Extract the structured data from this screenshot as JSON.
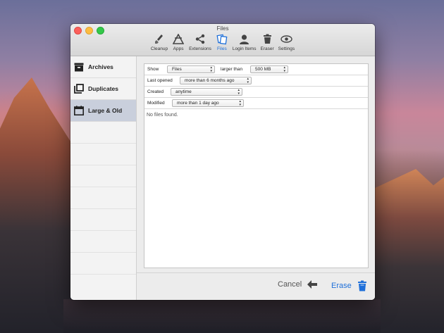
{
  "window": {
    "title": "Files"
  },
  "toolbar": {
    "items": [
      {
        "label": "Cleanup",
        "icon": "broom-icon"
      },
      {
        "label": "Apps",
        "icon": "apps-icon"
      },
      {
        "label": "Extensions",
        "icon": "share-icon"
      },
      {
        "label": "Files",
        "icon": "files-icon",
        "active": true
      },
      {
        "label": "Login Items",
        "icon": "user-icon"
      },
      {
        "label": "Eraser",
        "icon": "trash-icon"
      },
      {
        "label": "Settings",
        "icon": "settings-icon"
      }
    ]
  },
  "sidebar": {
    "items": [
      {
        "label": "Archives",
        "icon": "archive-icon"
      },
      {
        "label": "Duplicates",
        "icon": "duplicates-icon"
      },
      {
        "label": "Large & Old",
        "icon": "calendar-icon",
        "selected": true
      }
    ]
  },
  "filters": {
    "show_label": "Show",
    "show_value": "Files",
    "larger_than_label": "larger than",
    "larger_than_value": "500 MB",
    "last_opened_label": "Last opened",
    "last_opened_value": "more than 6 months ago",
    "created_label": "Created",
    "created_value": "anytime",
    "modified_label": "Modified",
    "modified_value": "more than 1 day ago"
  },
  "results": {
    "empty_text": "No files found."
  },
  "actions": {
    "cancel_label": "Cancel",
    "erase_label": "Erase"
  },
  "colors": {
    "accent": "#1e6fd9",
    "selected_row": "#c9cfdc"
  }
}
